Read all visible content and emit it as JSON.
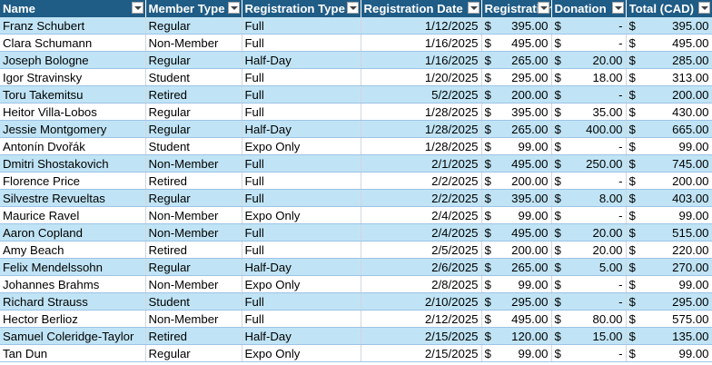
{
  "sheet": {
    "columns": [
      "Name",
      "Member Type",
      "Registration Type",
      "Registration Date",
      "Registration Fee",
      "Donation",
      "Total (CAD)"
    ],
    "currency_symbol": "$",
    "rows": [
      {
        "name": "Franz Schubert",
        "member": "Regular",
        "reg": "Full",
        "date": "1/12/2025",
        "fee": "395.00",
        "donation": "-",
        "total": "395.00"
      },
      {
        "name": "Clara Schumann",
        "member": "Non-Member",
        "reg": "Full",
        "date": "1/16/2025",
        "fee": "495.00",
        "donation": "-",
        "total": "495.00"
      },
      {
        "name": "Joseph Bologne",
        "member": "Regular",
        "reg": "Half-Day",
        "date": "1/16/2025",
        "fee": "265.00",
        "donation": "20.00",
        "total": "285.00"
      },
      {
        "name": "Igor Stravinsky",
        "member": "Student",
        "reg": "Full",
        "date": "1/20/2025",
        "fee": "295.00",
        "donation": "18.00",
        "total": "313.00"
      },
      {
        "name": "Toru Takemitsu",
        "member": "Retired",
        "reg": "Full",
        "date": "5/2/2025",
        "fee": "200.00",
        "donation": "-",
        "total": "200.00"
      },
      {
        "name": "Heitor Villa-Lobos",
        "member": "Regular",
        "reg": "Full",
        "date": "1/28/2025",
        "fee": "395.00",
        "donation": "35.00",
        "total": "430.00"
      },
      {
        "name": "Jessie Montgomery",
        "member": "Regular",
        "reg": "Half-Day",
        "date": "1/28/2025",
        "fee": "265.00",
        "donation": "400.00",
        "total": "665.00"
      },
      {
        "name": "Antonín Dvořák",
        "member": "Student",
        "reg": "Expo Only",
        "date": "1/28/2025",
        "fee": "99.00",
        "donation": "-",
        "total": "99.00"
      },
      {
        "name": "Dmitri Shostakovich",
        "member": "Non-Member",
        "reg": "Full",
        "date": "2/1/2025",
        "fee": "495.00",
        "donation": "250.00",
        "total": "745.00"
      },
      {
        "name": "Florence Price",
        "member": "Retired",
        "reg": "Full",
        "date": "2/2/2025",
        "fee": "200.00",
        "donation": "-",
        "total": "200.00"
      },
      {
        "name": "Silvestre Revueltas",
        "member": "Regular",
        "reg": "Full",
        "date": "2/2/2025",
        "fee": "395.00",
        "donation": "8.00",
        "total": "403.00"
      },
      {
        "name": "Maurice Ravel",
        "member": "Non-Member",
        "reg": "Expo Only",
        "date": "2/4/2025",
        "fee": "99.00",
        "donation": "-",
        "total": "99.00"
      },
      {
        "name": "Aaron Copland",
        "member": "Non-Member",
        "reg": "Full",
        "date": "2/4/2025",
        "fee": "495.00",
        "donation": "20.00",
        "total": "515.00"
      },
      {
        "name": "Amy Beach",
        "member": "Retired",
        "reg": "Full",
        "date": "2/5/2025",
        "fee": "200.00",
        "donation": "20.00",
        "total": "220.00"
      },
      {
        "name": "Felix Mendelssohn",
        "member": "Regular",
        "reg": "Half-Day",
        "date": "2/6/2025",
        "fee": "265.00",
        "donation": "5.00",
        "total": "270.00"
      },
      {
        "name": "Johannes Brahms",
        "member": "Non-Member",
        "reg": "Expo Only",
        "date": "2/8/2025",
        "fee": "99.00",
        "donation": "-",
        "total": "99.00"
      },
      {
        "name": "Richard Strauss",
        "member": "Student",
        "reg": "Full",
        "date": "2/10/2025",
        "fee": "295.00",
        "donation": "-",
        "total": "295.00"
      },
      {
        "name": "Hector Berlioz",
        "member": "Non-Member",
        "reg": "Full",
        "date": "2/12/2025",
        "fee": "495.00",
        "donation": "80.00",
        "total": "575.00"
      },
      {
        "name": "Samuel Coleridge-Taylor",
        "member": "Retired",
        "reg": "Half-Day",
        "date": "2/15/2025",
        "fee": "120.00",
        "donation": "15.00",
        "total": "135.00"
      },
      {
        "name": "Tan Dun",
        "member": "Regular",
        "reg": "Expo Only",
        "date": "2/15/2025",
        "fee": "99.00",
        "donation": "-",
        "total": "99.00"
      }
    ]
  },
  "colors": {
    "header_bg": "#1f5c86",
    "band_bg": "#c0e4f5",
    "row_bg": "#ffffff"
  }
}
